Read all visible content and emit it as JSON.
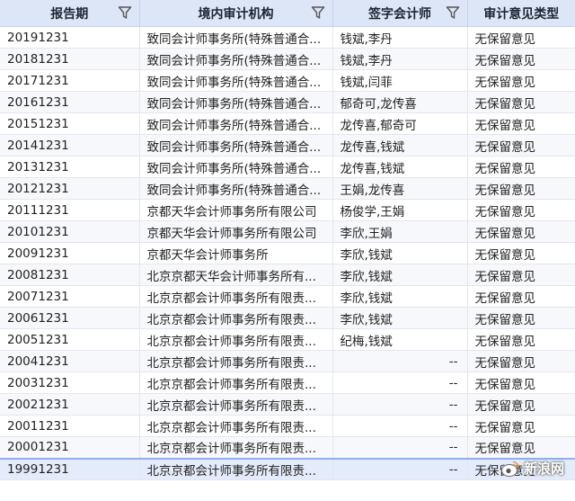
{
  "columns": [
    {
      "label": "报告期",
      "filter": true
    },
    {
      "label": "境内审计机构",
      "filter": true
    },
    {
      "label": "签字会计师",
      "filter": true
    },
    {
      "label": "审计意见类型",
      "filter": false
    }
  ],
  "rows": [
    {
      "period": "20191231",
      "firm": "致同会计师事务所(特殊普通合...",
      "cpa": "钱斌,李丹",
      "opinion": "无保留意见"
    },
    {
      "period": "20181231",
      "firm": "致同会计师事务所(特殊普通合...",
      "cpa": "钱斌,李丹",
      "opinion": "无保留意见"
    },
    {
      "period": "20171231",
      "firm": "致同会计师事务所(特殊普通合...",
      "cpa": "钱斌,闫菲",
      "opinion": "无保留意见"
    },
    {
      "period": "20161231",
      "firm": "致同会计师事务所(特殊普通合...",
      "cpa": "郁奇可,龙传喜",
      "opinion": "无保留意见"
    },
    {
      "period": "20151231",
      "firm": "致同会计师事务所(特殊普通合...",
      "cpa": "龙传喜,郁奇可",
      "opinion": "无保留意见"
    },
    {
      "period": "20141231",
      "firm": "致同会计师事务所(特殊普通合...",
      "cpa": "龙传喜,钱斌",
      "opinion": "无保留意见"
    },
    {
      "period": "20131231",
      "firm": "致同会计师事务所(特殊普通合...",
      "cpa": "龙传喜,钱斌",
      "opinion": "无保留意见"
    },
    {
      "period": "20121231",
      "firm": "致同会计师事务所(特殊普通合...",
      "cpa": "王娟,龙传喜",
      "opinion": "无保留意见"
    },
    {
      "period": "20111231",
      "firm": "京都天华会计师事务所有限公司",
      "cpa": "杨俊学,王娟",
      "opinion": "无保留意见"
    },
    {
      "period": "20101231",
      "firm": "京都天华会计师事务所有限公司",
      "cpa": "李欣,王娟",
      "opinion": "无保留意见"
    },
    {
      "period": "20091231",
      "firm": "京都天华会计师事务所",
      "cpa": "李欣,钱斌",
      "opinion": "无保留意见"
    },
    {
      "period": "20081231",
      "firm": "北京京都天华会计师事务所有...",
      "cpa": "李欣,钱斌",
      "opinion": "无保留意见"
    },
    {
      "period": "20071231",
      "firm": "北京京都会计师事务所有限责...",
      "cpa": "李欣,钱斌",
      "opinion": "无保留意见"
    },
    {
      "period": "20061231",
      "firm": "北京京都会计师事务所有限责...",
      "cpa": "李欣,钱斌",
      "opinion": "无保留意见"
    },
    {
      "period": "20051231",
      "firm": "北京京都会计师事务所有限责...",
      "cpa": "纪梅,钱斌",
      "opinion": "无保留意见"
    },
    {
      "period": "20041231",
      "firm": "北京京都会计师事务所有限责...",
      "cpa": "--",
      "opinion": "无保留意见"
    },
    {
      "period": "20031231",
      "firm": "北京京都会计师事务所有限责...",
      "cpa": "--",
      "opinion": "无保留意见"
    },
    {
      "period": "20021231",
      "firm": "北京京都会计师事务所有限责...",
      "cpa": "--",
      "opinion": "无保留意见"
    },
    {
      "period": "20011231",
      "firm": "北京京都会计师事务所有限责...",
      "cpa": "--",
      "opinion": "无保留意见"
    },
    {
      "period": "20001231",
      "firm": "北京京都会计师事务所有限责...",
      "cpa": "--",
      "opinion": "无保留意见"
    },
    {
      "period": "19991231",
      "firm": "北京京都会计师事务所有限责...",
      "cpa": "--",
      "opinion": "无保留意见"
    }
  ],
  "watermark": {
    "text": "新浪网",
    "icon": "sina-logo-icon"
  },
  "colors": {
    "header_bg": "#dde6f6",
    "filter_icon": "#555555",
    "selected_row": "#e4ebfa"
  }
}
